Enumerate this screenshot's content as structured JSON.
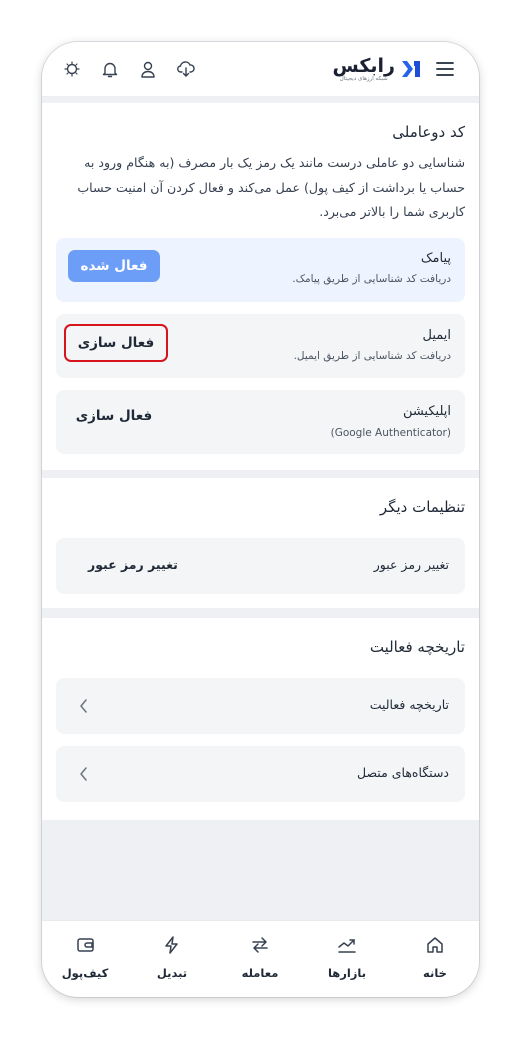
{
  "header": {
    "brand_name": "رابکس",
    "brand_tagline": "شبکه ارزهای دیجیتال",
    "icons": [
      "menu-icon",
      "download-cloud-icon",
      "user-icon",
      "bell-icon",
      "theme-sun-icon"
    ]
  },
  "two_factor": {
    "title": "کد دوعاملی",
    "description": "شناسایی دو عاملی درست مانند یک رمز یک بار مصرف (به هنگام ورود به حساب یا برداشت از کیف پول) عمل می‌کند و فعال کردن آن امنیت حساب کاربری شما را بالاتر می‌برد.",
    "methods": [
      {
        "title": "پیامک",
        "subtitle": "دریافت کد شناسایی از طریق پیامک.",
        "button": "فعال شده",
        "state": "active"
      },
      {
        "title": "ایمیل",
        "subtitle": "دریافت کد شناسایی از طریق ایمیل.",
        "button": "فعال سازی",
        "state": "highlighted"
      },
      {
        "title": "اپلیکیشن",
        "subtitle": "(Google Authenticator)",
        "button": "فعال سازی",
        "state": "inactive"
      }
    ]
  },
  "other_settings": {
    "title": "تنظیمات دیگر",
    "row_label": "تغییر رمز عبور",
    "row_action": "تغییر رمز عبور"
  },
  "activity": {
    "title": "تاریخچه فعالیت",
    "rows": [
      {
        "label": "تاریخچه فعالیت"
      },
      {
        "label": "دستگاه‌های متصل"
      }
    ]
  },
  "bottom_nav": {
    "tabs": [
      {
        "label": "خانه",
        "icon": "home-icon"
      },
      {
        "label": "بازارها",
        "icon": "markets-chart-icon"
      },
      {
        "label": "معامله",
        "icon": "trade-arrows-icon"
      },
      {
        "label": "تبدیل",
        "icon": "convert-lightning-icon"
      },
      {
        "label": "کیف‌پول",
        "icon": "wallet-icon"
      }
    ]
  },
  "colors": {
    "accent": "#6d9ef7",
    "brand_blue": "#2563eb",
    "highlight_border": "#d6141b",
    "card_active_bg": "#eef4ff",
    "card_bg": "#f4f5f7"
  }
}
